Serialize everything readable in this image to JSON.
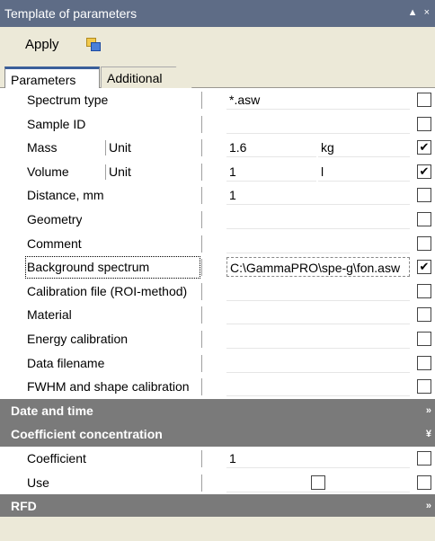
{
  "window": {
    "title": "Template of parameters",
    "controls": "▲ ×"
  },
  "toolbar": {
    "apply_label": "Apply",
    "copy_icon": "copy-icon"
  },
  "tabs": [
    {
      "label": "Parameters",
      "active": true
    },
    {
      "label": "Additional",
      "active": false
    }
  ],
  "rows": [
    {
      "label": "Spectrum type",
      "value": "*.asw",
      "checked": false
    },
    {
      "label": "Sample ID",
      "value": "",
      "checked": false
    },
    {
      "label": "Mass",
      "unit_label": "Unit",
      "value": "1.6",
      "unit_value": "kg",
      "checked": true
    },
    {
      "label": "Volume",
      "unit_label": "Unit",
      "value": "1",
      "unit_value": "l",
      "checked": true
    },
    {
      "label": "Distance, mm",
      "value": "1",
      "checked": false
    },
    {
      "label": "Geometry",
      "value": "",
      "checked": false
    },
    {
      "label": "Comment",
      "value": "",
      "checked": false
    },
    {
      "label": "Background spectrum",
      "value": "C:\\GammaPRO\\spe-g\\fon.asw",
      "checked": true
    },
    {
      "label": "Calibration file (ROI-method)",
      "value": "",
      "checked": false
    },
    {
      "label": "Material",
      "value": "",
      "checked": false
    },
    {
      "label": "Energy calibration",
      "value": "",
      "checked": false
    },
    {
      "label": "Data filename",
      "value": "",
      "checked": false
    },
    {
      "label": "FWHM and shape calibration",
      "value": "",
      "checked": false
    }
  ],
  "sections": {
    "date_time": {
      "label": "Date and time",
      "arrow": "»"
    },
    "coefficient": {
      "label": "Coefficient concentration",
      "arrow": "¥"
    },
    "rfd": {
      "label": "RFD",
      "arrow": "»"
    }
  },
  "coef_rows": [
    {
      "label": "Coefficient",
      "value": "1",
      "checked": false
    },
    {
      "label": "Use",
      "value": "",
      "inline_checkbox": true,
      "checked": false
    }
  ],
  "check_mark": "✔"
}
